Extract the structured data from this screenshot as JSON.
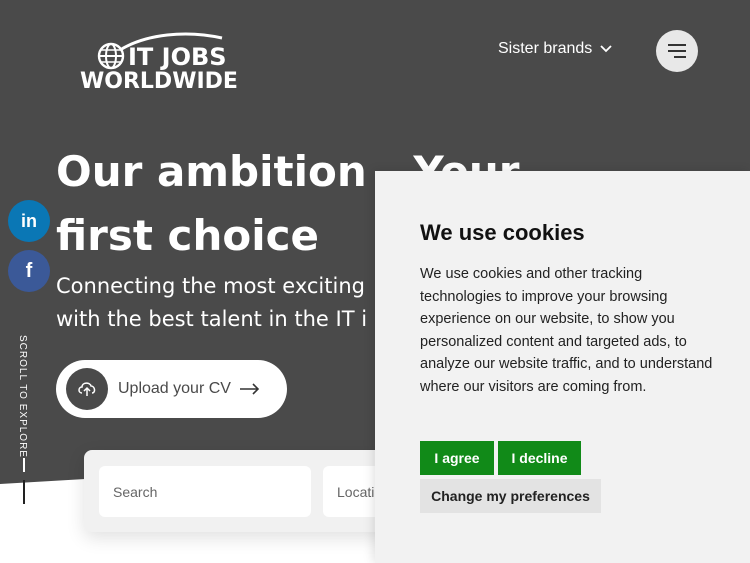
{
  "brand": {
    "logo_line1": "IT JOBS",
    "logo_line2": "WORLDWIDE"
  },
  "header": {
    "sister_brands_label": "Sister brands",
    "menu_icon": "menu-icon"
  },
  "hero": {
    "headline_line1": "Our ambition - Your",
    "headline_line2": "first choice",
    "subline_line1": "Connecting the most exciting",
    "subline_line2": "with the best talent in the IT i",
    "upload_label": "Upload your CV"
  },
  "social": {
    "linkedin_label": "in",
    "facebook_label": "f"
  },
  "scroll": {
    "label": "SCROLL TO EXPLORE"
  },
  "search": {
    "search_placeholder": "Search",
    "location_placeholder": "Locatio"
  },
  "cookie_banner": {
    "title": "We use cookies",
    "body": "We use cookies and other tracking technologies to improve your browsing experience on our website, to show you personalized content and targeted ads, to analyze our website traffic, and to understand where our visitors are coming from.",
    "agree_label": "I agree",
    "decline_label": "I decline",
    "preferences_label": "Change my preferences"
  },
  "colors": {
    "hero_bg": "#4a4a4a",
    "accent_green": "#118a18",
    "linkedin": "#0a77b5",
    "facebook": "#3b5998"
  }
}
